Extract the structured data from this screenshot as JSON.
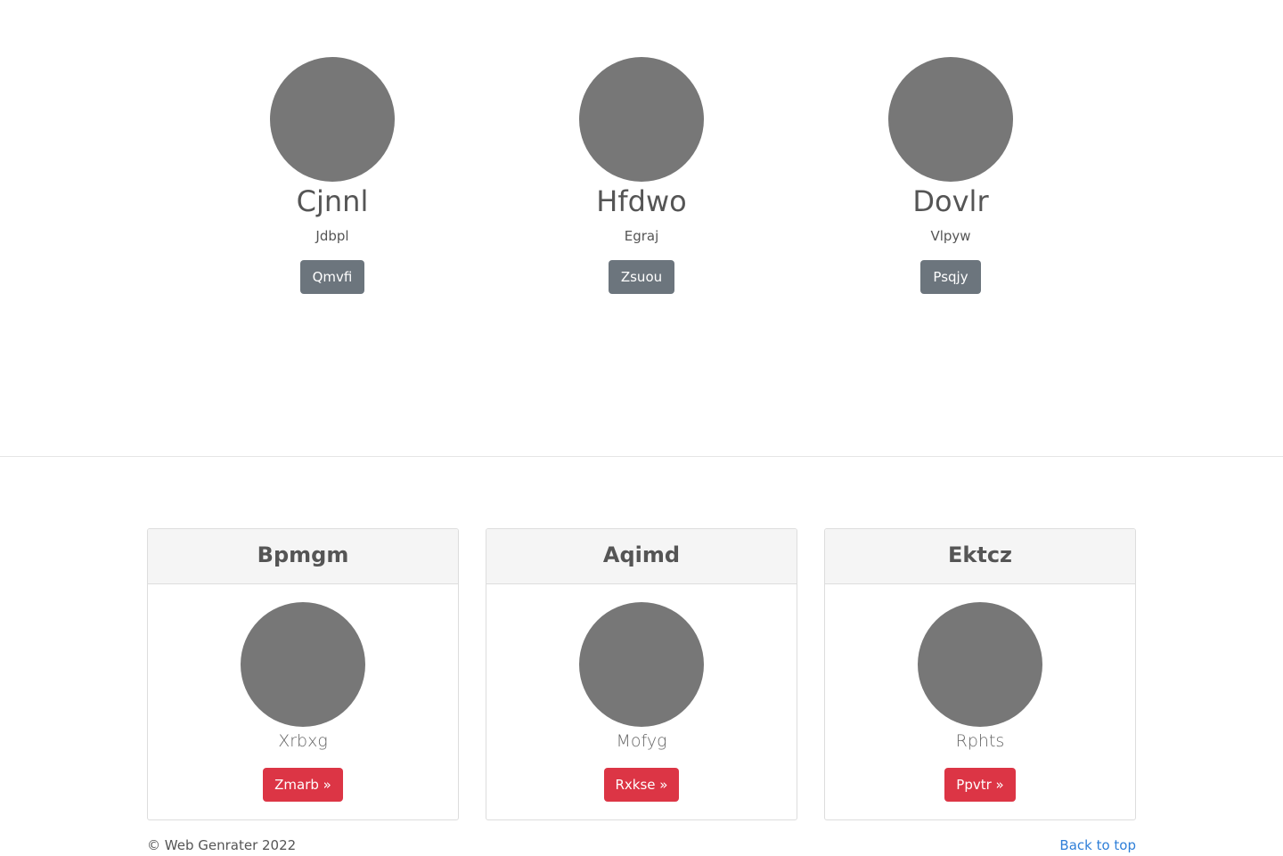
{
  "people": [
    {
      "name": "Cjnnl",
      "subtitle": "Jdbpl",
      "button": "Qmvfi"
    },
    {
      "name": "Hfdwo",
      "subtitle": "Egraj",
      "button": "Zsuou"
    },
    {
      "name": "Dovlr",
      "subtitle": "Vlpyw",
      "button": "Psqjy"
    }
  ],
  "cards": [
    {
      "title": "Bpmgm",
      "label": "Xrbxg",
      "button": "Zmarb »"
    },
    {
      "title": "Aqimd",
      "label": "Mofyg",
      "button": "Rxkse »"
    },
    {
      "title": "Ektcz",
      "label": "Rphts",
      "button": "Ppvtr »"
    }
  ],
  "footer": {
    "copyright": "© Web Genrater 2022",
    "back_to_top": "Back to top"
  },
  "colors": {
    "avatar": "#777777",
    "secondary_button": "#6c757d",
    "danger_button": "#dc3545",
    "link": "#2f7fd8"
  }
}
